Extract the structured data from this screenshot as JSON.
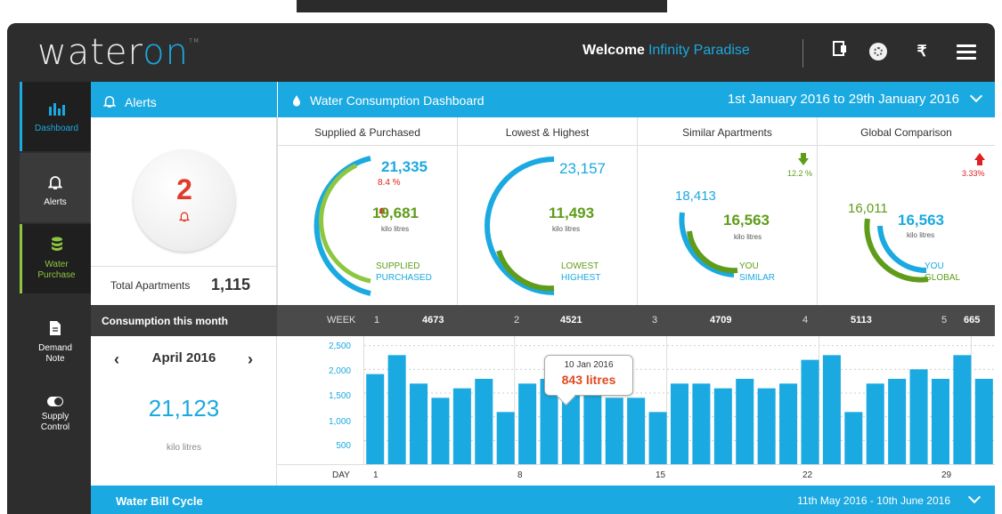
{
  "header": {
    "logo_prefix": "water",
    "logo_accent": "on",
    "logo_tm": "TM",
    "welcome": "Welcome",
    "user_name": "Infinity Paradise",
    "rupee": "₹"
  },
  "colors": {
    "accent": "#1aa9e0",
    "green": "#8dc63f",
    "dark": "#2d2d2d",
    "alert_red": "#e23a2a"
  },
  "sidebar": {
    "items": [
      {
        "label": "Dashboard",
        "icon": "bar-chart-icon"
      },
      {
        "label": "Alerts",
        "icon": "bell-icon"
      },
      {
        "label": "Water Purchase",
        "icon": "database-icon"
      },
      {
        "label": "Demand Note",
        "icon": "document-icon"
      },
      {
        "label": "Supply Control",
        "icon": "toggle-icon"
      }
    ]
  },
  "alerts": {
    "title": "Alerts",
    "count": "2",
    "total_label": "Total Apartments",
    "total_value": "1,115"
  },
  "dashboard": {
    "title": "Water Consumption Dashboard",
    "date_range": "1st January 2016 to 29th January 2016"
  },
  "cards": {
    "supplied": {
      "title": "Supplied & Purchased",
      "top": "21,335",
      "pct": "8.4 %",
      "main": "19,681",
      "unit": "kilo litres",
      "l1": "SUPPLIED",
      "l2": "PURCHASED"
    },
    "lowest": {
      "title": "Lowest & Highest",
      "top": "23,157",
      "main": "11,493",
      "unit": "kilo litres",
      "l1": "LOWEST",
      "l2": "HIGHEST"
    },
    "similar": {
      "title": "Similar Apartments",
      "pct": "12.2 %",
      "top": "18,413",
      "main": "16,563",
      "unit": "kilo litres",
      "l1": "YOU",
      "l2": "SIMILAR"
    },
    "global": {
      "title": "Global Comparison",
      "pct": "3.33%",
      "top": "16,011",
      "main": "16,563",
      "unit": "kilo litres",
      "l1": "YOU",
      "l2": "GLOBAL"
    }
  },
  "consumption": {
    "title": "Consumption this month",
    "week_label": "WEEK",
    "weeks": [
      {
        "n": "1",
        "v": "4673"
      },
      {
        "n": "2",
        "v": "4521"
      },
      {
        "n": "3",
        "v": "4709"
      },
      {
        "n": "4",
        "v": "5113"
      },
      {
        "n": "5",
        "v": "665"
      }
    ],
    "month": "April 2016",
    "month_value": "21,123",
    "month_unit": "kilo litres",
    "day_label": "DAY",
    "tooltip_date": "10 Jan 2016",
    "tooltip_value": "843 litres"
  },
  "chart_data": {
    "type": "bar",
    "xlabel": "DAY",
    "ylim": [
      0,
      2700
    ],
    "yticks": [
      "2,500",
      "2,000",
      "1,500",
      "1,000",
      "500"
    ],
    "xticks": [
      "1",
      "8",
      "15",
      "22",
      "29"
    ],
    "values": [
      1900,
      2300,
      1700,
      1400,
      1600,
      1800,
      1100,
      1700,
      1800,
      1800,
      1700,
      1400,
      1400,
      1100,
      1700,
      1700,
      1600,
      1800,
      1600,
      1700,
      2200,
      2300,
      1100,
      1700,
      1800,
      2000,
      1800,
      2300,
      1800
    ],
    "color": "#1aa9e0"
  },
  "bill": {
    "title": "Water Bill Cycle",
    "range": "11th May 2016 - 10th June 2016"
  }
}
